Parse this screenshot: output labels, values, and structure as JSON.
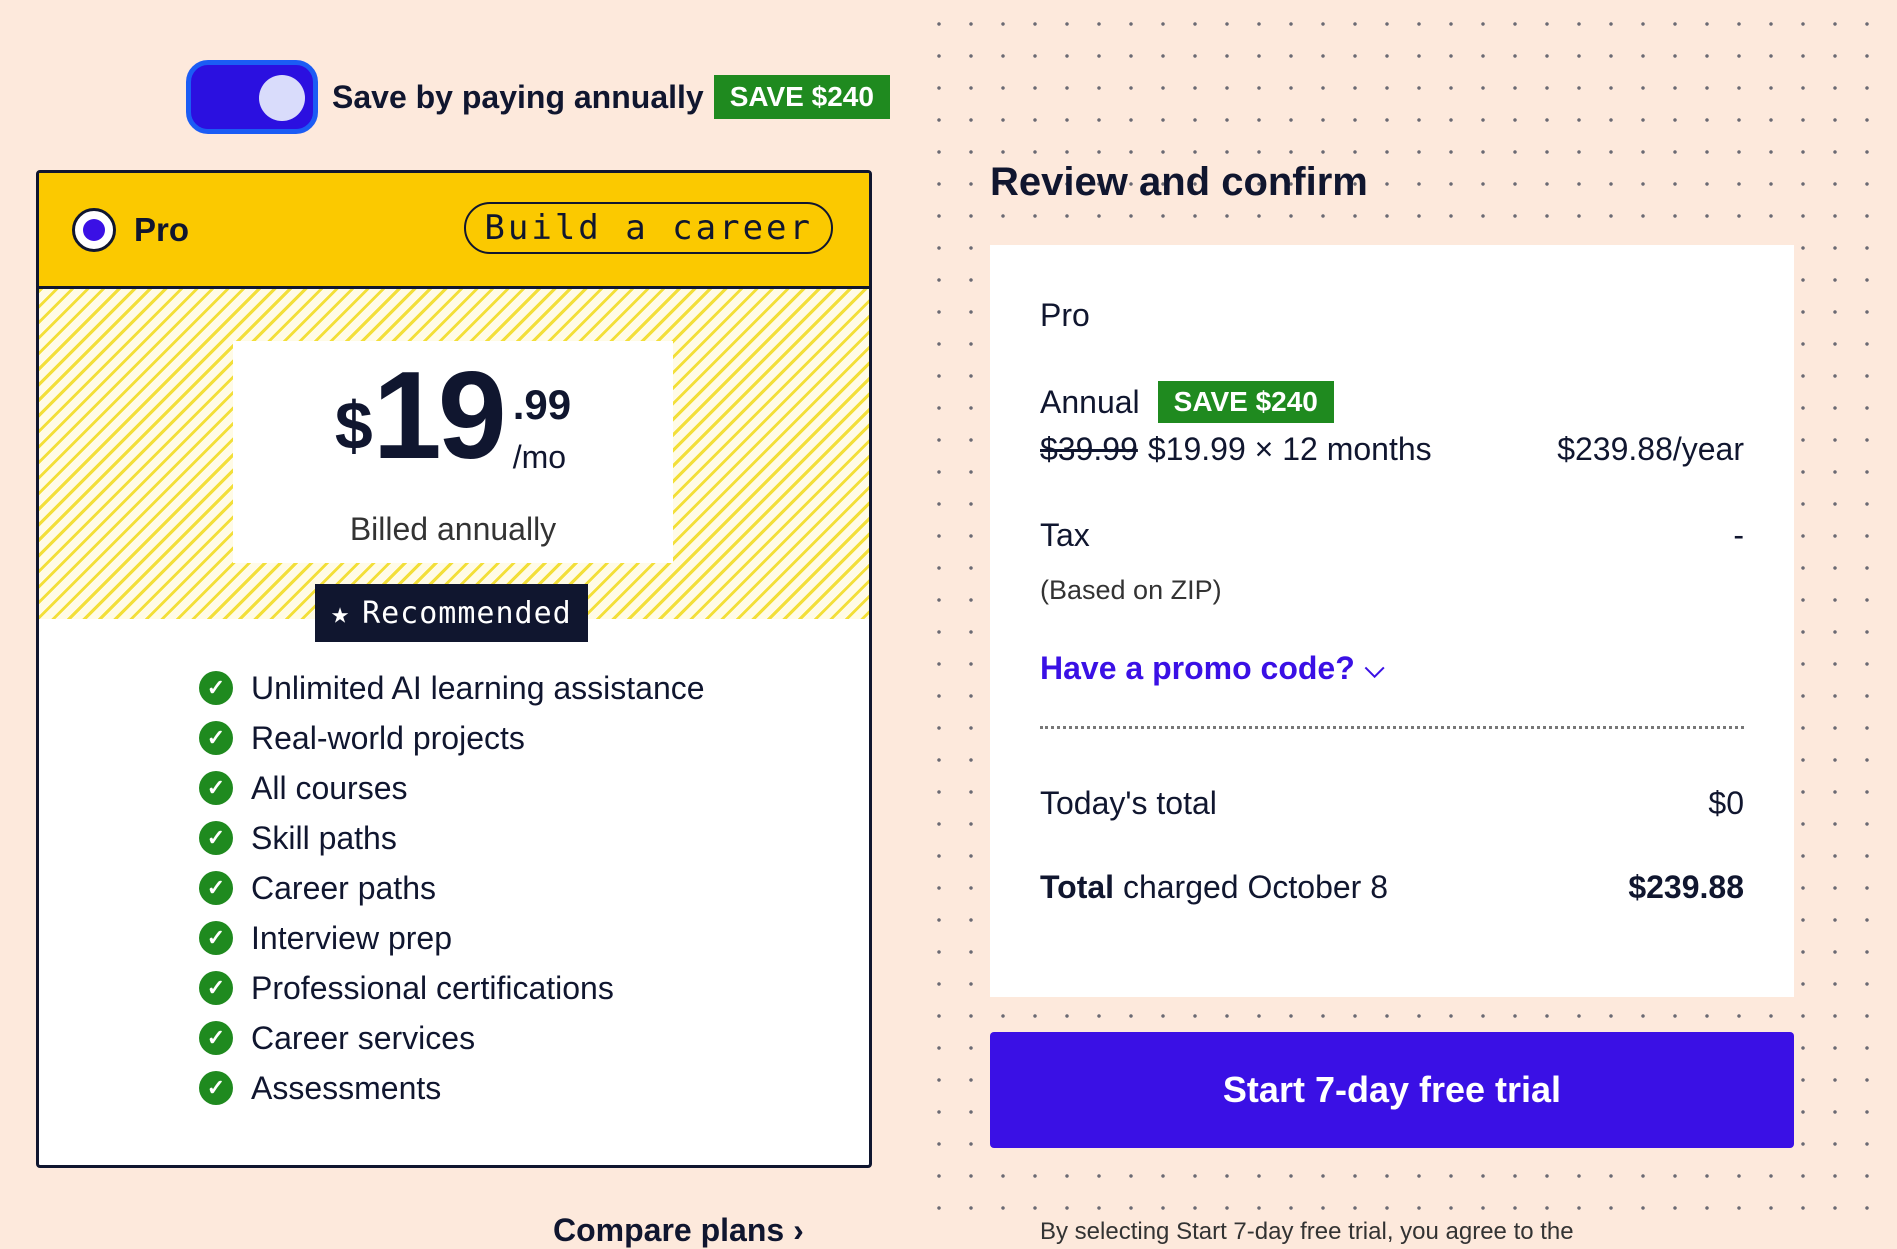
{
  "billing_toggle": {
    "label": "Save by paying annually",
    "badge": "SAVE $240",
    "on": true
  },
  "plan_card": {
    "name": "Pro",
    "tag": "Build a career",
    "price": {
      "currency": "$",
      "dollars": "19",
      "cents": ".99",
      "per": "/mo"
    },
    "billed": "Billed annually",
    "recommended": "Recommended",
    "features": [
      "Unlimited AI learning assistance",
      "Real-world projects",
      "All courses",
      "Skill paths",
      "Career paths",
      "Interview prep",
      "Professional certifications",
      "Career services",
      "Assessments"
    ],
    "compare_link": "Compare plans"
  },
  "review": {
    "title": "Review and confirm",
    "plan": "Pro",
    "period": "Annual",
    "badge": "SAVE $240",
    "old_price": "$39.99",
    "price_line": "$19.99 × 12 months",
    "yearly": "$239.88/year",
    "tax_label": "Tax",
    "tax_value": "-",
    "tax_note": "(Based on ZIP)",
    "promo": "Have a promo code?",
    "today_label": "Today's total",
    "today_value": "$0",
    "total_label_bold": "Total",
    "total_label_rest": " charged October 8",
    "total_value": "$239.88",
    "cta": "Start 7-day free trial",
    "legal": "By selecting Start 7-day free trial, you agree to the"
  },
  "colors": {
    "accent": "#3a10e5",
    "save_green": "#1f8a1f",
    "plan_yellow": "#fbc900",
    "background": "#fde9dc"
  },
  "icons": [
    "toggle-switch",
    "radio-selected-icon",
    "star-icon",
    "check-circle-icon",
    "chevron-down-icon",
    "chevron-right-icon"
  ]
}
